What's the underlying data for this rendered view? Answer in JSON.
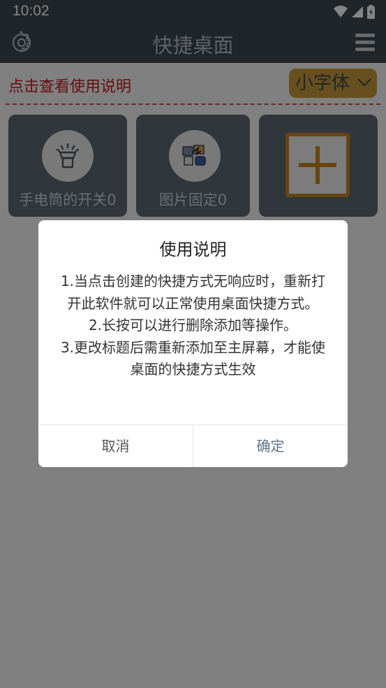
{
  "status_bar": {
    "time": "10:02"
  },
  "app_bar": {
    "title": "快捷桌面"
  },
  "toolbar": {
    "help_link": "点击查看使用说明",
    "font_size_selected": "小字体"
  },
  "tiles": [
    {
      "label": "手电筒的开关0",
      "icon": "flashlight-icon"
    },
    {
      "label": "图片固定0",
      "icon": "pinned-images-icon"
    },
    {
      "label": "",
      "icon": "add-icon"
    }
  ],
  "dialog": {
    "title": "使用说明",
    "lines": [
      "1.当点击创建的快捷方式无响应时，重新打开此软件就可以正常使用桌面快捷方式。",
      "2.长按可以进行删除添加等操作。",
      "3.更改标题后需重新添加至主屏幕，才能使桌面的快捷方式生效"
    ],
    "cancel_label": "取消",
    "confirm_label": "确定"
  },
  "colors": {
    "app_bar": "#3e4850",
    "accent_gold": "#c59a3b",
    "link_red": "#c41b1b",
    "tile_bg": "#5c6872",
    "confirm_text": "#5f7486"
  }
}
